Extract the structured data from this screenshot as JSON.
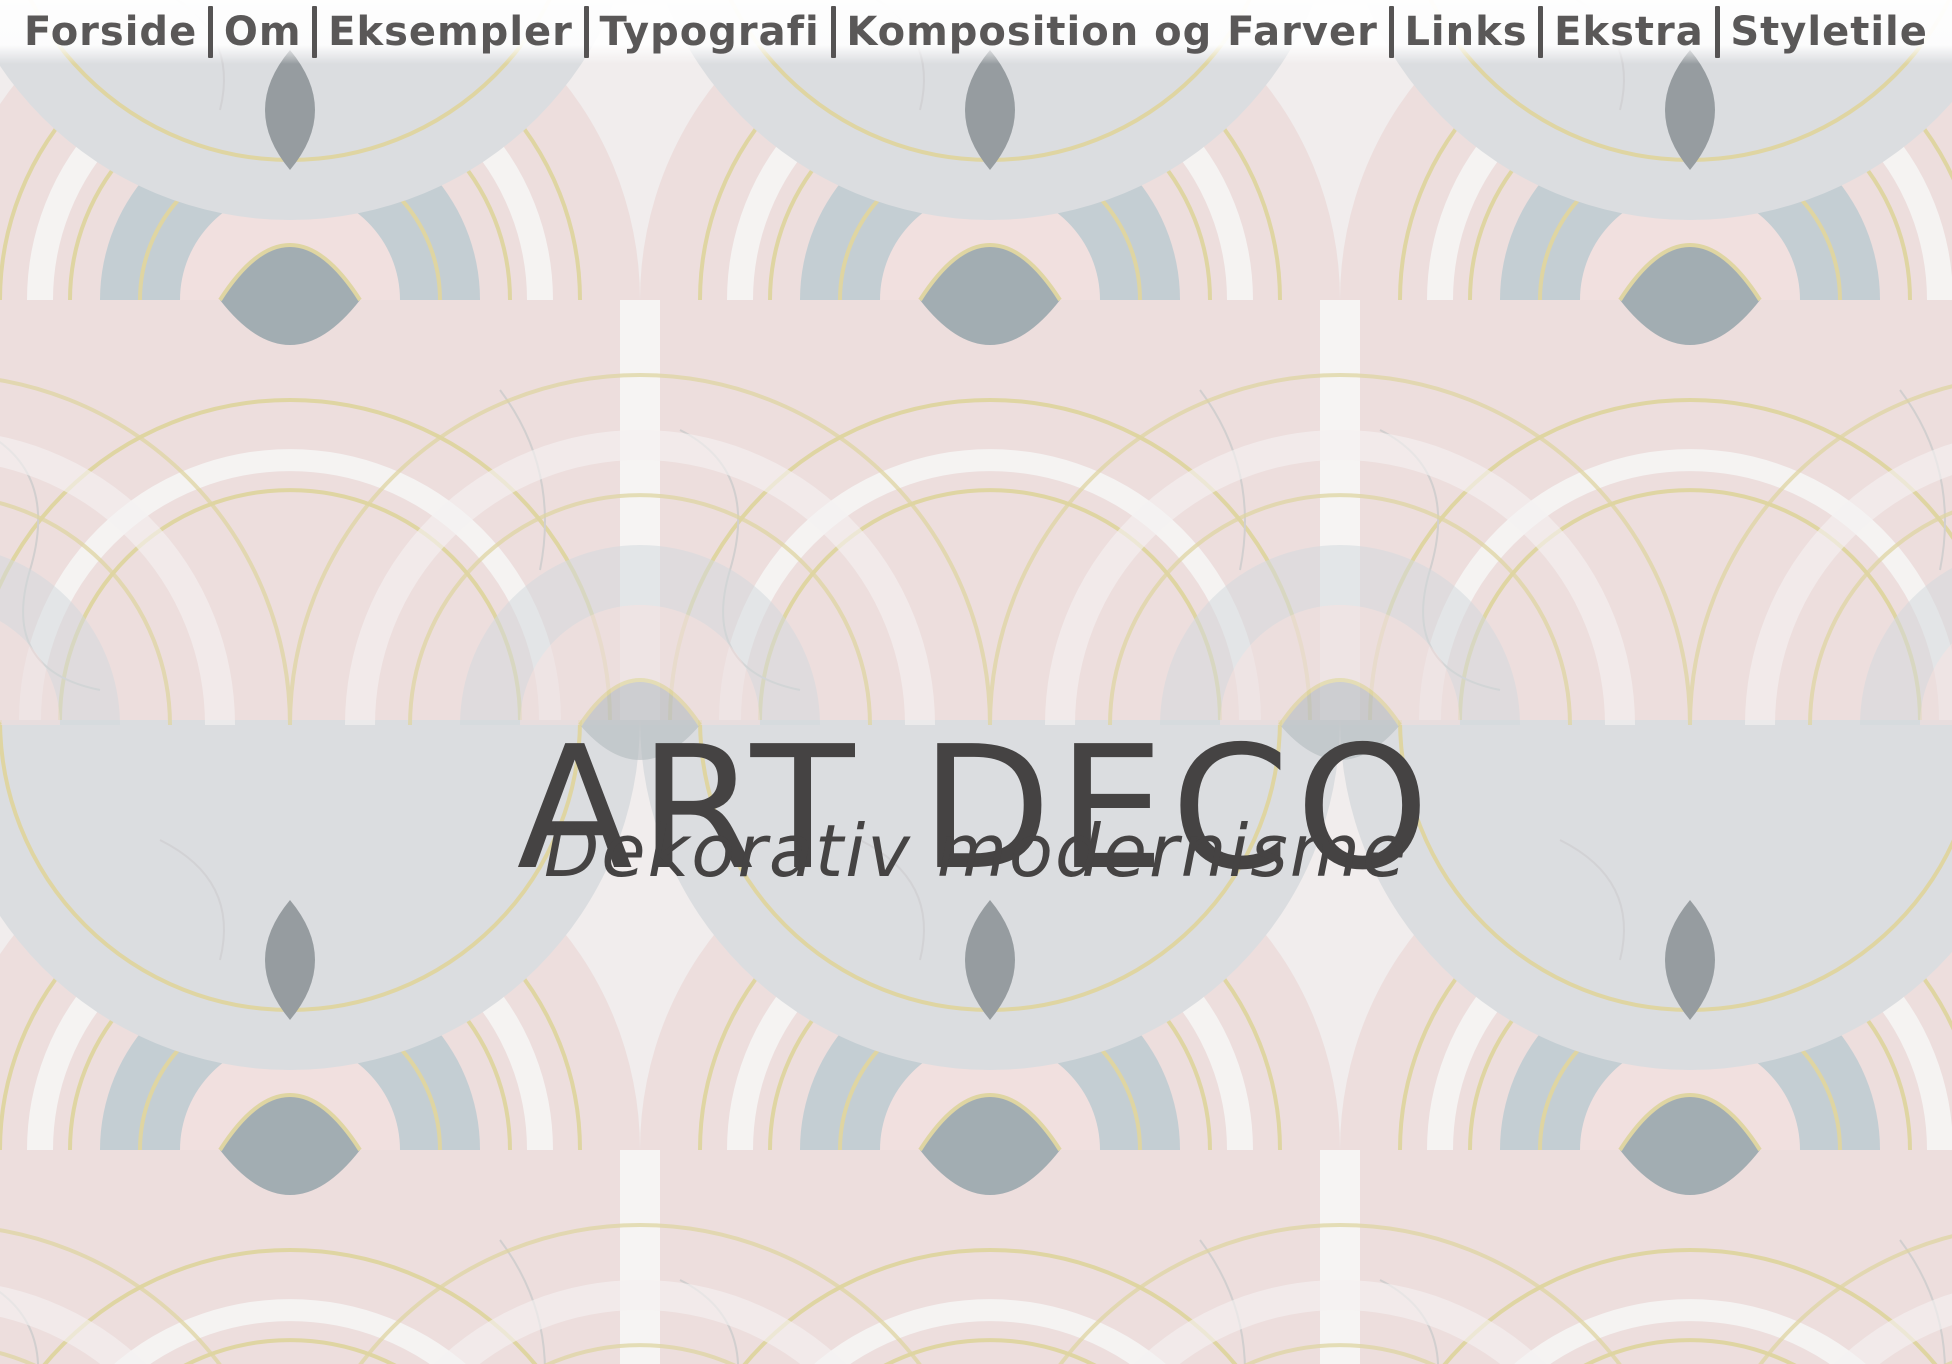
{
  "nav": {
    "items": [
      {
        "label": "Forside"
      },
      {
        "label": "Om"
      },
      {
        "label": "Eksempler"
      },
      {
        "label": "Typografi"
      },
      {
        "label": "Komposition og Farver"
      },
      {
        "label": "Links"
      },
      {
        "label": "Ekstra"
      },
      {
        "label": "Styletile"
      }
    ]
  },
  "hero": {
    "title": "ART DECO",
    "subtitle": "Dekorativ modernisme"
  },
  "colors": {
    "text": "#454343",
    "nav_text": "#5a5858",
    "marble_white": "#f1eeee",
    "marble_pink": "#e8cfcf",
    "marble_blue": "#a9b8bf",
    "marble_grey": "#8a8f94",
    "gold_line": "#d8cc8e"
  },
  "background": {
    "description_icon": "art-deco-marble-tile-pattern"
  }
}
